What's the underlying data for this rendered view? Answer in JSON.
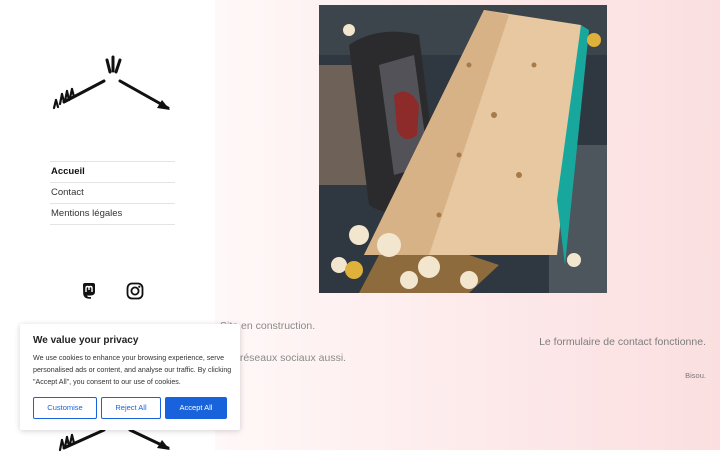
{
  "nav": {
    "items": [
      {
        "label": "Accueil",
        "active": true
      },
      {
        "label": "Contact",
        "active": false
      },
      {
        "label": "Mentions légales",
        "active": false
      }
    ]
  },
  "social": {
    "icons": [
      "mastodon-icon",
      "instagram-icon"
    ]
  },
  "content": {
    "line1": "Site en construction.",
    "line2": "Le formulaire de contact fonctionne.",
    "line3": "Les réseaux sociaux aussi.",
    "line4": "Bisou."
  },
  "cookie": {
    "title": "We value your privacy",
    "body": "We use cookies to enhance your browsing experience, serve personalised ads or content, and analyse our traffic. By clicking \"Accept All\", you consent to our use of cookies.",
    "customise_label": "Customise",
    "reject_label": "Reject All",
    "accept_label": "Accept All"
  },
  "colors": {
    "accent": "#1863dc",
    "background_tint": "#fde9ea"
  }
}
